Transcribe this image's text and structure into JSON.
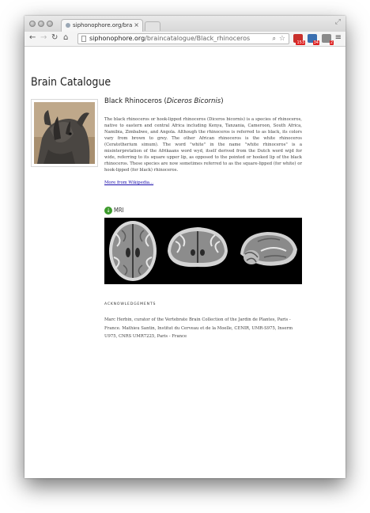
{
  "browser": {
    "tab_title": "siphonophore.org/brainca",
    "tab_close": "×",
    "url_host": "siphonophore.org",
    "url_path": "/braincatalogue/Black_rhinoceros",
    "extensions": [
      {
        "name": "ext-red-icon",
        "badge": "153",
        "color": "#c9302c"
      },
      {
        "name": "ext-blue-icon",
        "badge": "34",
        "color": "#3a6fb0"
      },
      {
        "name": "ext-grey-icon",
        "badge": "2",
        "color": "#8a8a8a"
      }
    ]
  },
  "page": {
    "title": "Brain Catalogue",
    "species_common": "Black Rhinoceros (",
    "species_latin": "Diceros Bicornis",
    "species_close": ")",
    "description": "The black rhinoceros or hook-lipped rhinoceros (Diceros bicornis) is a species of rhinoceros, native to eastern and central Africa including Kenya, Tanzania, Cameroon, South Africa, Namibia, Zimbabwe, and Angola. Although the rhinoceros is referred to as black, its colors vary from brown to grey. The other African rhinoceros is the white rhinoceros (Ceratotherium simum). The word \"white\" in the name \"white rhinoceros\" is a misinterpretation of the Afrikaans word wyd, itself derived from the Dutch word wijd for wide, referring to its square upper lip, as opposed to the pointed or hooked lip of the black rhinoceros. These species are now sometimes referred to as the square-lipped (for white) or hook-lipped (for black) rhinoceros.",
    "more_link": "More from Wikipedia...",
    "mri_label": "MRI",
    "ack_heading": "ACKNOWLEDGEMENTS",
    "ack_text": "Marc Herbin, curator of the Vertebrate Brain Collection of the Jardin de Plantes, Paris - France. Mathieu Santin, Institut du Cerveau et de la Moelle, CENIR, UMR-S975, Inserm U975, CNRS UMR7225, Paris - France"
  }
}
